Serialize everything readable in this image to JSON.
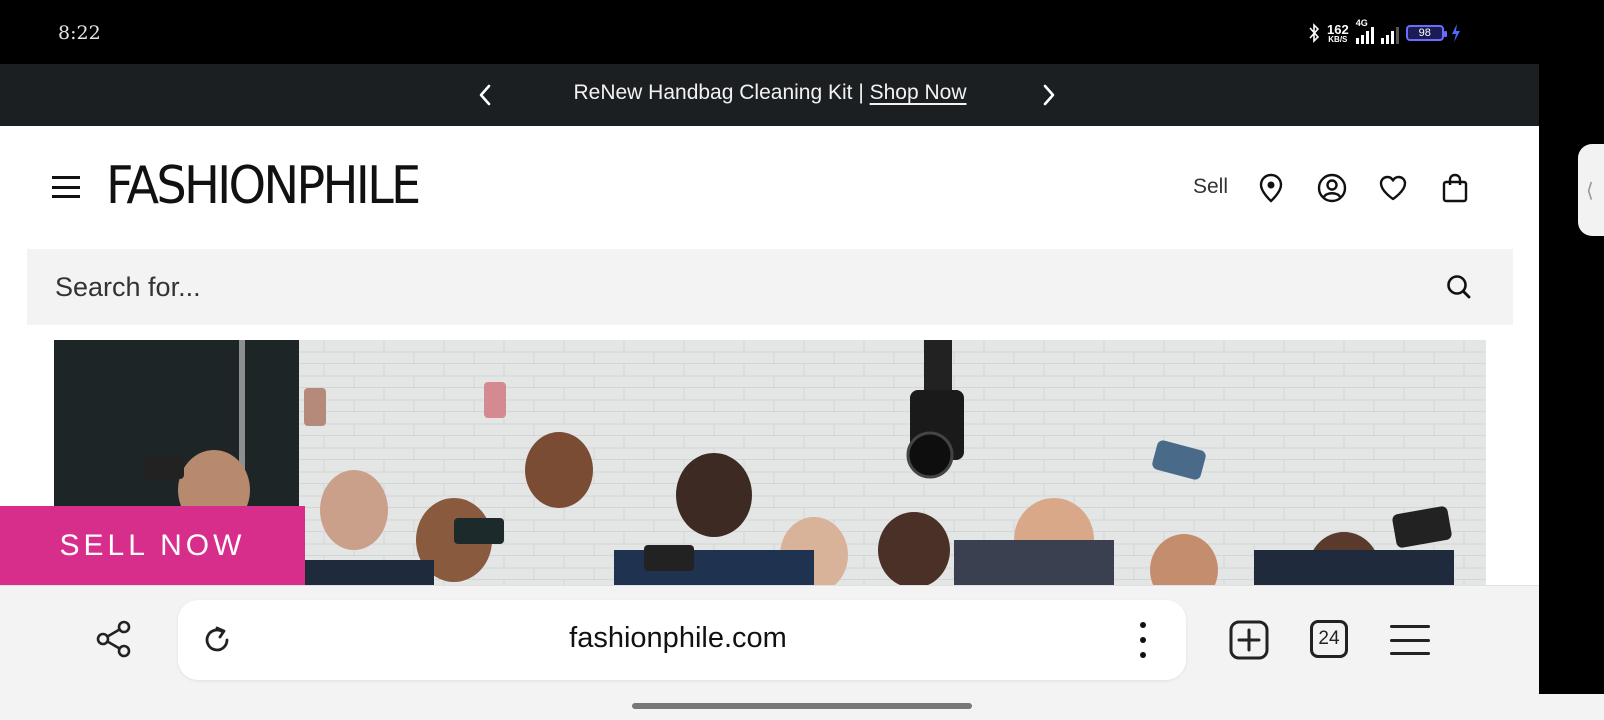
{
  "status_bar": {
    "time": "8:22",
    "net_speed_value": "162",
    "net_speed_unit": "KB/S",
    "network_type": "4G",
    "battery_level": "98"
  },
  "promo": {
    "text": "ReNew Handbag Cleaning Kit | ",
    "link_label": "Shop Now"
  },
  "header": {
    "logo": "FASHIONPHILE",
    "sell_label": "Sell"
  },
  "search": {
    "placeholder": "Search for..."
  },
  "hero": {
    "sell_now_label": "SELL NOW"
  },
  "browser": {
    "url": "fashionphile.com",
    "tab_count": "24"
  },
  "colors": {
    "promo_bg": "#1c1f22",
    "sell_now_bg": "#d82e8b",
    "search_bg": "#f3f3f3",
    "browser_bar_bg": "#f3f3f3"
  },
  "icons": [
    "bluetooth-icon",
    "signal-icon",
    "battery-icon",
    "charging-icon",
    "chevron-left-icon",
    "chevron-right-icon",
    "hamburger-menu-icon",
    "location-pin-icon",
    "account-icon",
    "heart-icon",
    "shopping-bag-icon",
    "search-icon",
    "share-icon",
    "reload-icon",
    "more-vertical-icon",
    "new-tab-icon",
    "tabs-icon",
    "browser-menu-icon"
  ]
}
